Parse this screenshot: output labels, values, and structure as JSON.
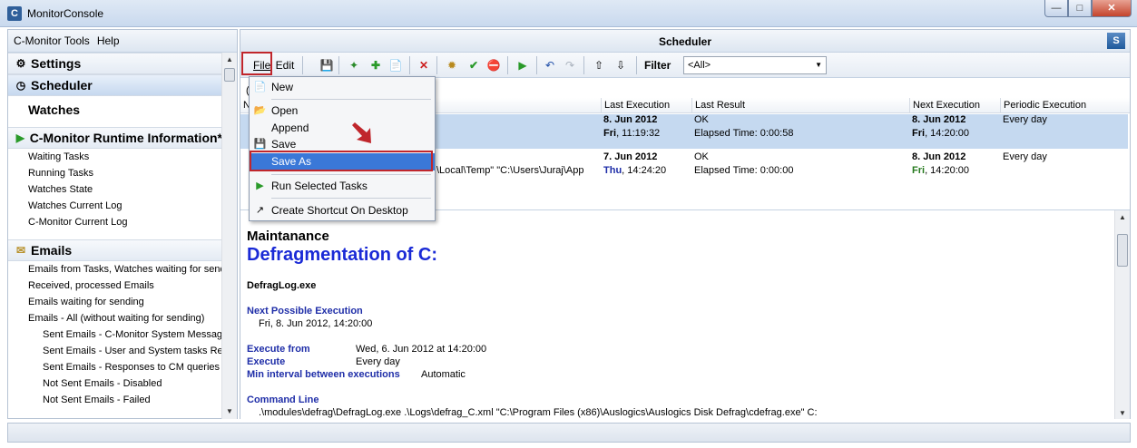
{
  "window": {
    "title": "MonitorConsole",
    "app_icon": "C",
    "buttons": [
      "minimize",
      "maximize",
      "close"
    ]
  },
  "left": {
    "menu": [
      "C-Monitor Tools",
      "Help"
    ],
    "sections": [
      {
        "label": "Settings",
        "icon": "gear-icon"
      },
      {
        "label": "Scheduler",
        "icon": "scheduler-icon",
        "selected": true
      },
      {
        "label": "Watches",
        "icon": ""
      },
      {
        "label": "C-Monitor Runtime Information*",
        "icon": "play-icon"
      }
    ],
    "runtime_items": [
      "Waiting Tasks",
      "Running Tasks",
      "Watches State",
      "Watches Current Log",
      "C-Monitor Current Log"
    ],
    "emails_section": {
      "label": "Emails",
      "icon": "envelope-icon"
    },
    "email_items": [
      "Emails from Tasks, Watches waiting for sendi",
      "Received, processed Emails",
      "Emails waiting for sending",
      "Emails - All (without waiting for sending)"
    ],
    "email_subitems": [
      "Sent Emails - C-Monitor System Message",
      "Sent Emails - User and System tasks Res",
      "Sent Emails - Responses to CM queries",
      "Not Sent Emails - Disabled",
      "Not Sent Emails - Failed"
    ]
  },
  "scheduler": {
    "title": "Scheduler",
    "toolbar": {
      "file": "File",
      "edit": "Edit",
      "filter_label": "Filter",
      "filter_value": "<All>"
    },
    "columns": {
      "name": "N",
      "last_execution": "Last Execution",
      "last_result": "Last Result",
      "next_execution": "Next Execution",
      "periodic": "Periodic Execution"
    },
    "row_prefix": "(",
    "rows": [
      {
        "cmd": "",
        "last_date": "8. Jun 2012",
        "last_day": "Fri",
        "last_time": ", 11:19:32",
        "result": "OK",
        "elapsed": "Elapsed Time: 0:00:58",
        "next_date": "8. Jun 2012",
        "next_day": "Fri",
        "next_time": ", 14:20:00",
        "periodic": "Every day"
      },
      {
        "cmd": "\\Local\\Temp\" \"C:\\Users\\Juraj\\App",
        "last_date": "7. Jun 2012",
        "last_day": "Thu",
        "last_time": ", 14:24:20",
        "result": "OK",
        "elapsed": "Elapsed Time: 0:00:00",
        "next_date": "8. Jun 2012",
        "next_day": "Fri",
        "next_time": ", 14:20:00",
        "periodic": "Every day"
      }
    ]
  },
  "detail": {
    "category": "Maintanance",
    "title": "Defragmentation of C:",
    "exe": "DefragLog.exe",
    "next_possible_label": "Next Possible Execution",
    "next_possible_value": "Fri, 8. Jun 2012, 14:20:00",
    "execute_from_label": "Execute from",
    "execute_from_value": "Wed, 6. Jun 2012 at 14:20:00",
    "execute_label": "Execute",
    "execute_value": "Every day",
    "min_interval_label": "Min interval between executions",
    "min_interval_value": "Automatic",
    "command_line_label": "Command Line",
    "command_line_value": ".\\modules\\defrag\\DefragLog.exe .\\Logs\\defrag_C.xml \"C:\\Program Files (x86)\\Auslogics\\Auslogics Disk Defrag\\cdefrag.exe\" C:"
  },
  "file_menu": {
    "items": [
      {
        "label": "New",
        "icon": "new-document-icon"
      },
      {
        "label": "Open",
        "icon": "open-folder-icon"
      },
      {
        "label": "Append",
        "icon": ""
      },
      {
        "label": "Save",
        "icon": "floppy-disk-icon"
      },
      {
        "label": "Save As",
        "icon": "",
        "highlighted": true
      },
      {
        "label": "Run Selected Tasks",
        "icon": "play-icon"
      },
      {
        "label": "Create Shortcut On Desktop",
        "icon": "shortcut-icon"
      }
    ]
  },
  "colors": {
    "highlight_box": "#c0262c",
    "menu_hover": "#3a78d8",
    "detail_title": "#1a2ad6",
    "label_blue": "#1f2ea8",
    "day_green": "#267a1e"
  }
}
